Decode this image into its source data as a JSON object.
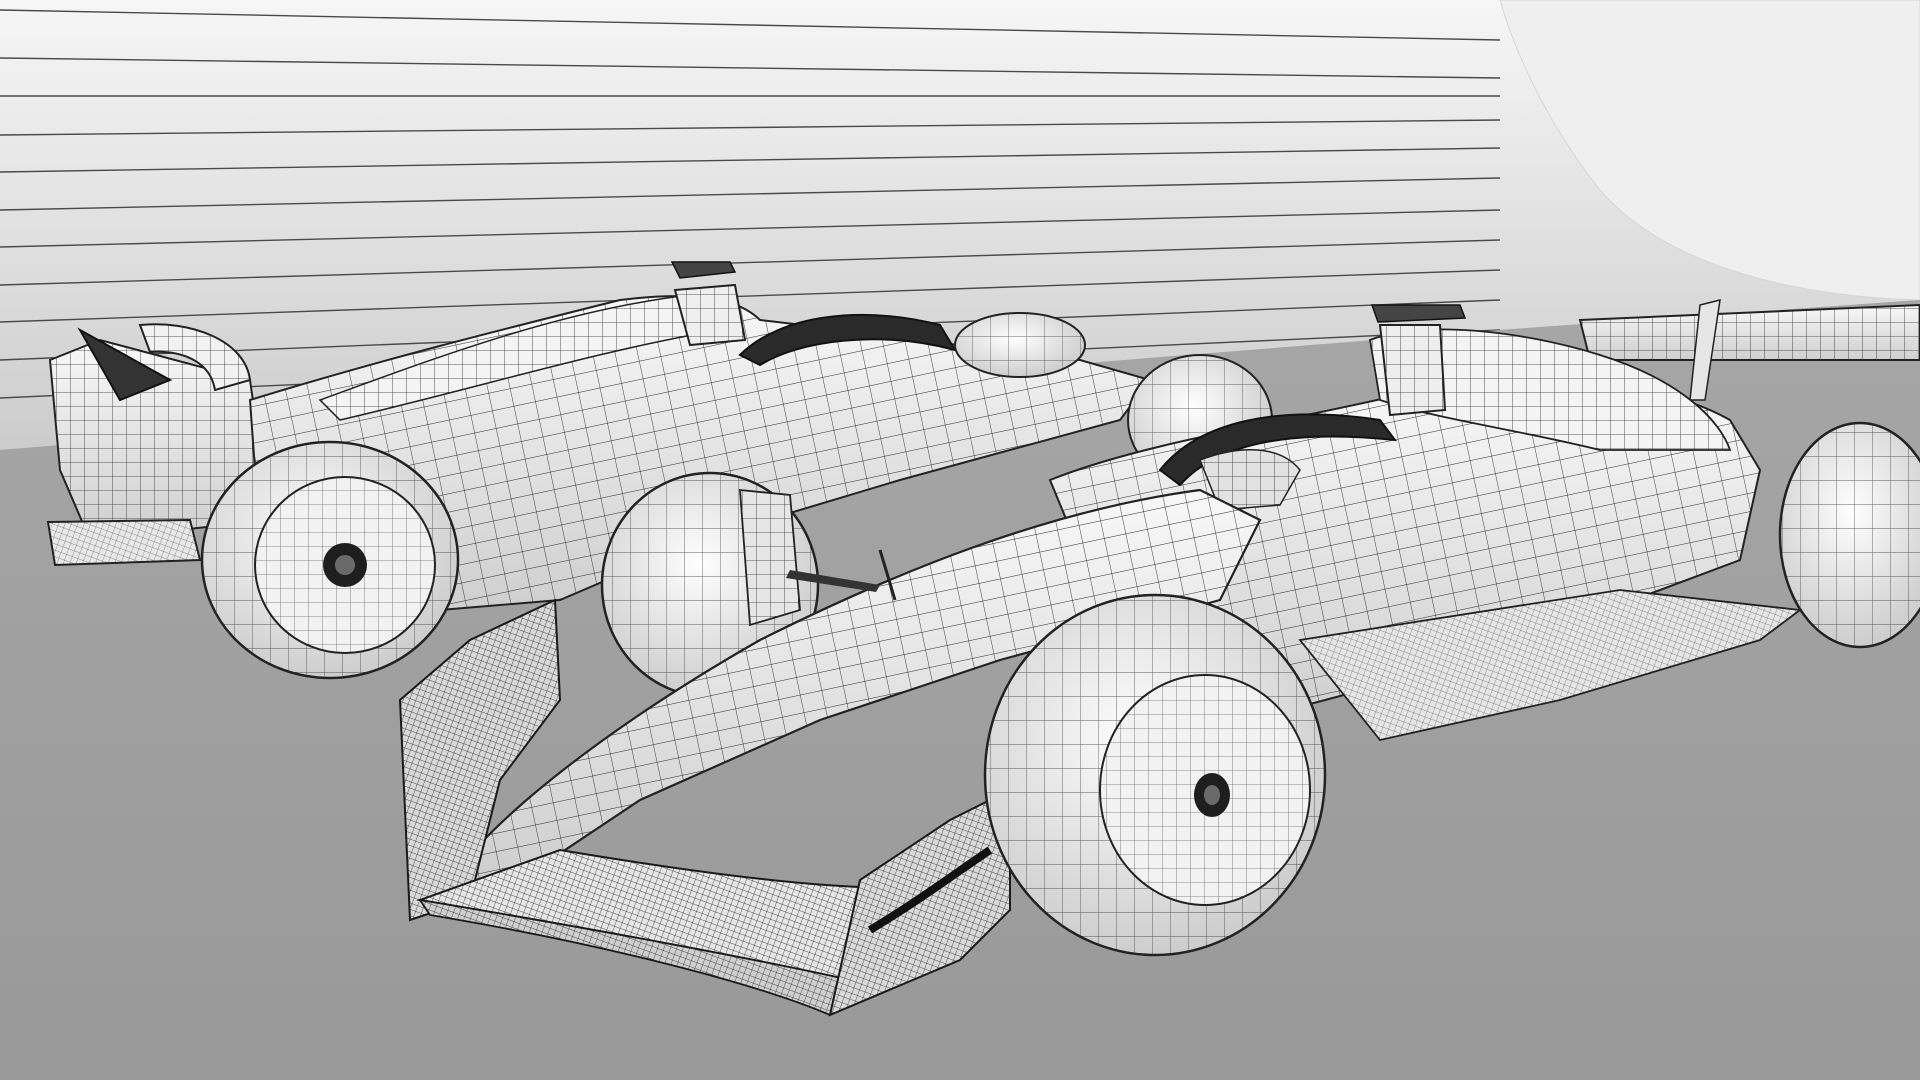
{
  "scene": {
    "subject": "two-formula-cars-wireframe-render",
    "colors": {
      "floor": "#9d9d9d",
      "wall_top": "#f4f4f4",
      "wall_bottom": "#cfcfcf",
      "body": "#f0f0f0",
      "body_shade": "#d2d2d2",
      "mesh": "#2a2a2a",
      "tyre": "#e8e8e8",
      "dark": "#1a1a1a",
      "curtain": "#ececec"
    }
  }
}
